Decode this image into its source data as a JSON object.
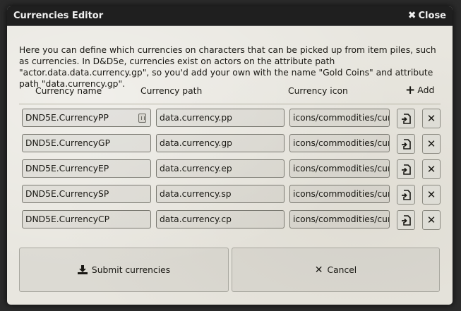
{
  "window": {
    "title": "Currencies Editor",
    "close_label": "Close"
  },
  "intro": {
    "text": "Here you can define which currencies on characters that can be picked up from item piles, such as currencies. In D&D5e, currencies exist on actors on the attribute path \"actor.data.data.currency.gp\", so you'd add your own with the name \"Gold Coins\" and attribute path \"data.currency.gp\"."
  },
  "columns": {
    "name": "Currency name",
    "path": "Currency path",
    "icon": "Currency icon",
    "add_label": "Add"
  },
  "rows": [
    {
      "name": "DND5E.CurrencyPP",
      "path": "data.currency.pp",
      "icon": "icons/commodities/currency/coin-inset-snail-silver.webp"
    },
    {
      "name": "DND5E.CurrencyGP",
      "path": "data.currency.gp",
      "icon": "icons/commodities/currency/coin-embossed-crown-gold.webp"
    },
    {
      "name": "DND5E.CurrencyEP",
      "path": "data.currency.ep",
      "icon": "icons/commodities/currency/coin-inset-copper-axe.webp"
    },
    {
      "name": "DND5E.CurrencySP",
      "path": "data.currency.sp",
      "icon": "icons/commodities/currency/coin-engraved-moon-silver.webp"
    },
    {
      "name": "DND5E.CurrencyCP",
      "path": "data.currency.cp",
      "icon": "icons/commodities/currency/coin-engraved-waves-copper.webp"
    }
  ],
  "buttons": {
    "submit_label": "Submit currencies",
    "cancel_label": "Cancel"
  },
  "icons": {
    "close": "close-icon",
    "add": "plus-icon",
    "file_picker": "file-import-icon",
    "delete": "times-icon",
    "submit": "download-icon",
    "cancel": "times-icon",
    "dice": "dice-icon"
  }
}
